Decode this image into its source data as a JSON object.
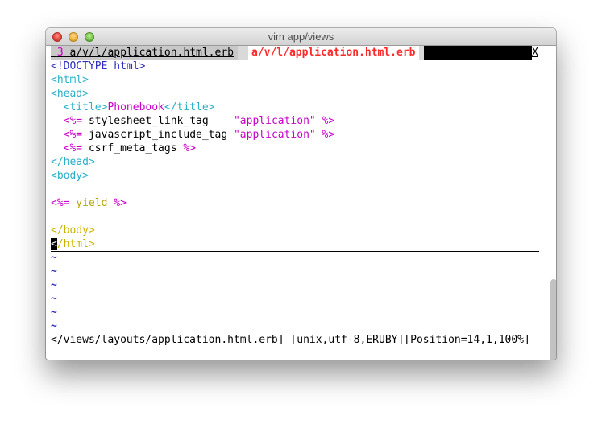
{
  "window": {
    "title": "vim app/views"
  },
  "tabline": {
    "inactive_tab": {
      "number": "3",
      "label": "a/v/l/application.html.erb"
    },
    "active_tab": {
      "label": "a/v/l/application.html.erb"
    },
    "close_label": "X"
  },
  "editor": {
    "lines": {
      "l1": {
        "doctype": "<!DOCTYPE html>"
      },
      "l2": {
        "tag": "<html>"
      },
      "l3": {
        "tag": "<head>"
      },
      "l4": {
        "indent": "  ",
        "open": "<title>",
        "text": "Phonebook",
        "close": "</title>"
      },
      "l5": {
        "indent": "  ",
        "erb_open": "<%=",
        "code": " stylesheet_link_tag    ",
        "string": "\"application\"",
        "erb_close": " %>"
      },
      "l6": {
        "indent": "  ",
        "erb_open": "<%=",
        "code": " javascript_include_tag ",
        "string": "\"application\"",
        "erb_close": " %>"
      },
      "l7": {
        "indent": "  ",
        "erb_open": "<%=",
        "code": " csrf_meta_tags",
        "erb_close": " %>"
      },
      "l8": {
        "tag": "</head>"
      },
      "l9": {
        "tag": "<body>"
      },
      "l10": {
        "text": ""
      },
      "l11": {
        "erb_open": "<%=",
        "code": " yield",
        "erb_close": " %>"
      },
      "l12": {
        "text": ""
      },
      "l13": {
        "tag": "</body>"
      },
      "l14": {
        "cursor_char": "<",
        "rest": "/html>"
      }
    },
    "empty_line_marker": "~"
  },
  "statusline": {
    "text": "</views/layouts/application.html.erb] [unix,utf-8,ERUBY][Position=14,1,100%]"
  },
  "colors": {
    "tag": "#2ab0c8",
    "erb": "#c800c8",
    "doctype": "#3030c0",
    "active_tab": "#ff2a2a"
  }
}
